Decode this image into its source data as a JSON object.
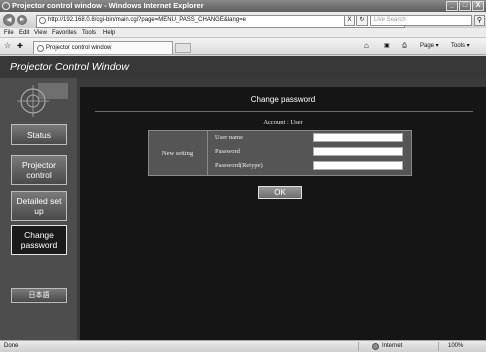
{
  "window": {
    "title": "Projector control window - Windows Internet Explorer",
    "minimize": "_",
    "maximize": "□",
    "close": "X"
  },
  "address": {
    "url": "http://192.168.0.8/cgi-bin/main.cgi?page=MENU_PASS_CHANGE&lang=e",
    "refresh": "↻",
    "stop": "X",
    "search_placeholder": "Live Search",
    "back": "◄",
    "forward": "►"
  },
  "menu": [
    "File",
    "Edit",
    "View",
    "Favorites",
    "Tools",
    "Help"
  ],
  "tab": {
    "title": "Projector control window"
  },
  "commands": {
    "page": "Page ▾",
    "tools": "Tools ▾"
  },
  "app": {
    "header": "Projector Control Window",
    "nav": [
      {
        "label": "Status"
      },
      {
        "label": "Projector control"
      },
      {
        "label": "Detailed set up"
      },
      {
        "label": "Change password"
      },
      {
        "label": "日本語"
      }
    ],
    "change_password": {
      "title": "Change password",
      "account_label": "Account",
      "account_sep": ":",
      "account_value": "User",
      "section_label": "New setting",
      "fields": {
        "username": "User name",
        "password": "Password",
        "password_retype": "Password(Retype)"
      },
      "ok": "OK"
    }
  },
  "statusbar": {
    "text": "Done",
    "zone": "Internet",
    "zoom": "100%"
  }
}
